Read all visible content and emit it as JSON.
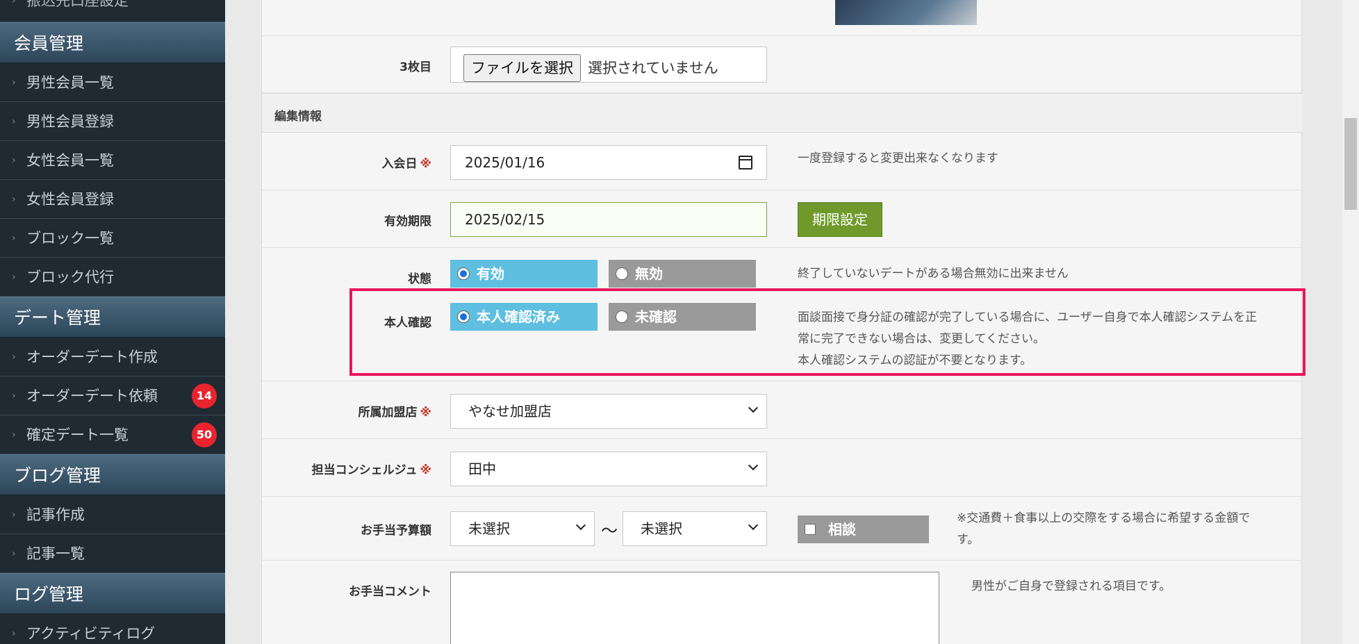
{
  "sidebar": {
    "top_item": "振込先口座設定",
    "sections": [
      {
        "title": "会員管理",
        "items": [
          "男性会員一覧",
          "男性会員登録",
          "女性会員一覧",
          "女性会員登録",
          "ブロック一覧",
          "ブロック代行"
        ]
      },
      {
        "title": "デート管理",
        "items": [
          "オーダーデート作成",
          "オーダーデート依頼",
          "確定デート一覧"
        ],
        "badges": {
          "order_request": "14",
          "confirmed": "50"
        }
      },
      {
        "title": "ブログ管理",
        "items": [
          "記事作成",
          "記事一覧"
        ]
      },
      {
        "title": "ログ管理",
        "items": [
          "アクティビティログ"
        ]
      }
    ]
  },
  "form": {
    "photo3": {
      "label": "3枚目",
      "button": "ファイルを選択",
      "status": "選択されていません"
    },
    "section_title": "編集情報",
    "join_date": {
      "label": "入会日",
      "required": "※",
      "value": "2025/01/16",
      "note": "一度登録すると変更出来なくなります"
    },
    "expiry": {
      "label": "有効期限",
      "value": "2025/02/15",
      "button": "期限設定"
    },
    "status": {
      "label": "状態",
      "options": [
        "有効",
        "無効"
      ],
      "selected": "有効",
      "note": "終了していないデートがある場合無効に出来ません"
    },
    "identity": {
      "label": "本人確認",
      "options": [
        "本人確認済み",
        "未確認"
      ],
      "selected": "本人確認済み",
      "note_lines": [
        "面談面接で身分証の確認が完了している場合に、ユーザー自身で本人確認システムを正",
        "常に完了できない場合は、変更してください。",
        "本人確認システムの認証が不要となります。"
      ]
    },
    "store": {
      "label": "所属加盟店",
      "required": "※",
      "value": "やなせ加盟店"
    },
    "concierge": {
      "label": "担当コンシェルジュ",
      "required": "※",
      "value": "田中"
    },
    "budget": {
      "label": "お手当予算額",
      "from": "未選択",
      "tilde": "〜",
      "to": "未選択",
      "consult": "相談",
      "note_lines": [
        "※交通費＋食事以上の交際をする場合に希望する金額で",
        "す。"
      ]
    },
    "comment": {
      "label": "お手当コメント",
      "note": "男性がご自身で登録される項目です。"
    }
  },
  "colors": {
    "accent_highlight": "#e8175d",
    "radio_on": "#5ebfe0",
    "radio_off": "#9a9a9a",
    "button_green": "#6f9a2b",
    "badge": "#e8242f"
  }
}
